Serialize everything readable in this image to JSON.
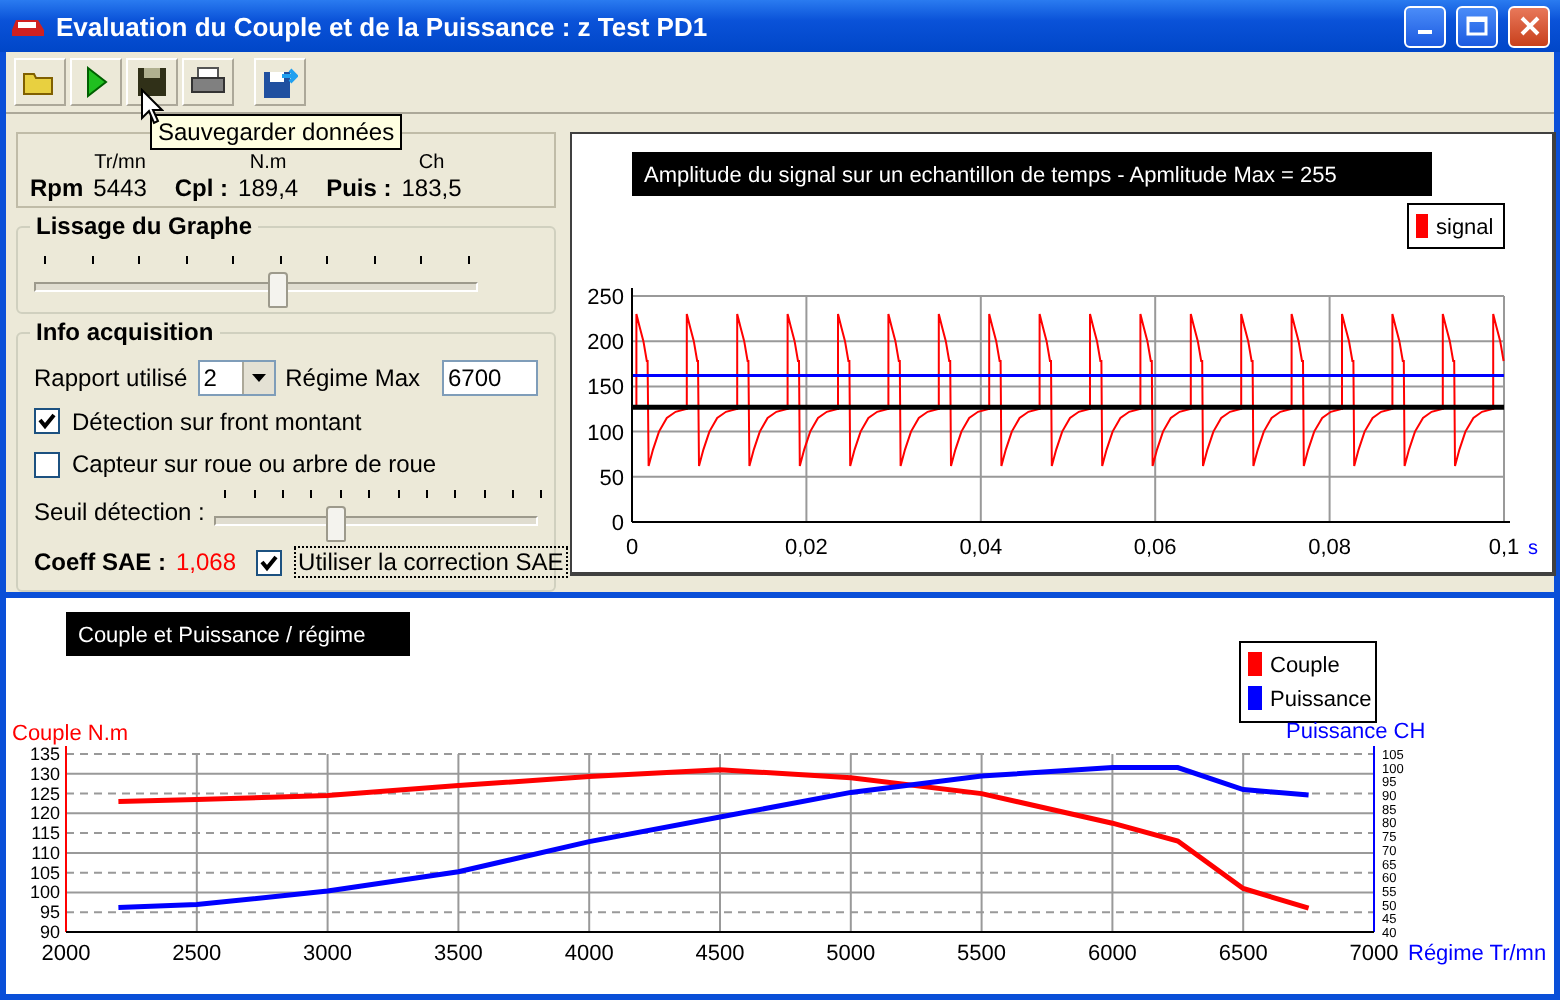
{
  "window": {
    "title": "Evaluation du Couple et de la Puissance : z Test PD1"
  },
  "tooltip": "Sauvegarder données",
  "readings": [
    {
      "label": "Rpm",
      "unit": "Tr/mn",
      "value": "5443"
    },
    {
      "label": "Cpl :",
      "unit": "N.m",
      "value": "189,4"
    },
    {
      "label": "Puis :",
      "unit": "Ch",
      "value": "183,5"
    }
  ],
  "smoothing": {
    "title": "Lissage du Graphe",
    "level": 0.55
  },
  "acquisition": {
    "title": "Info acquisition",
    "gear_label": "Rapport utilisé",
    "gear_value": "2",
    "max_rpm_label": "Régime Max",
    "max_rpm_value": "6700",
    "checkboxes": [
      {
        "label": "Détection sur front montant",
        "checked": true
      },
      {
        "label": "Capteur sur roue ou arbre de roue",
        "checked": false
      }
    ],
    "threshold": {
      "label": "Seuil détection :",
      "level": 0.35
    },
    "sae_label": "Coeff SAE :",
    "sae_value": "1,068",
    "sae_correction": {
      "label": "Utiliser la correction SAE",
      "checked": true
    }
  },
  "signal_chart": {
    "title": "Amplitude du signal sur un echantillon de temps - Apmlitude Max = 255",
    "legend": [
      {
        "label": "signal",
        "color": "#ff0000"
      }
    ],
    "yticks": [
      "250",
      "200",
      "150",
      "100",
      "50",
      "0"
    ],
    "xticks": [
      "0",
      "0,02",
      "0,04",
      "0,06",
      "0,08",
      "0,1"
    ],
    "x_unit": "s"
  },
  "power_chart": {
    "chart_data": {
      "type": "line",
      "title": "Couple et Puissance / régime",
      "xlabel": "Régime Tr/mn",
      "ylabel": "Couple N.m",
      "y2label": "Puissance CH",
      "x": [
        2200,
        2500,
        3000,
        3500,
        4000,
        4500,
        5000,
        5500,
        6000,
        6250,
        6500,
        6750
      ],
      "series": [
        {
          "name": "Couple",
          "color": "#ff0000",
          "values": [
            123,
            123.5,
            124.5,
            127,
            129.3,
            131,
            129,
            125,
            117.5,
            113,
            101,
            96
          ]
        },
        {
          "name": "Puissance",
          "color": "#0000ff",
          "axis": "y2",
          "values": [
            49,
            50,
            55,
            62,
            73,
            82,
            91,
            97,
            100,
            100,
            92,
            90
          ]
        }
      ],
      "grid": true,
      "legend": true,
      "xlim": [
        2000,
        7000
      ],
      "ylim": [
        90,
        135
      ],
      "y2lim": [
        40,
        105
      ],
      "xticks": [
        2000,
        2500,
        3000,
        3500,
        4000,
        4500,
        5000,
        5500,
        6000,
        6500,
        7000
      ],
      "yticks": [
        90,
        95,
        100,
        105,
        110,
        115,
        120,
        125,
        130,
        135
      ],
      "y2ticks": [
        40,
        45,
        50,
        55,
        60,
        65,
        70,
        75,
        80,
        85,
        90,
        95,
        100,
        105
      ]
    }
  }
}
